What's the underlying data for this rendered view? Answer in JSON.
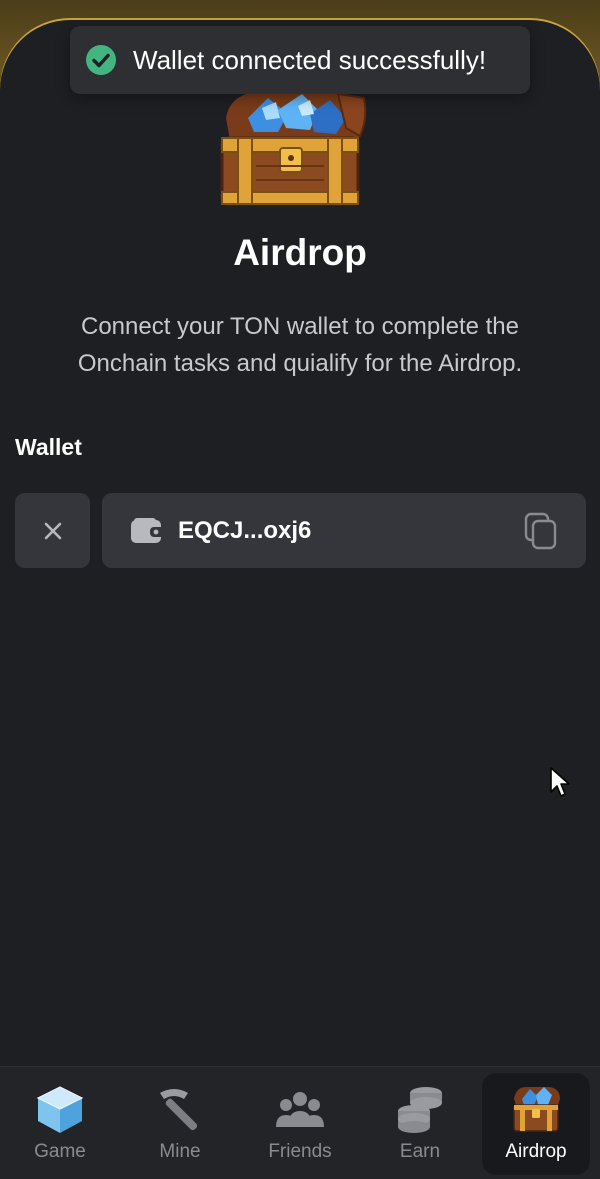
{
  "toast": {
    "message": "Wallet connected successfully!",
    "icon": "check-circle-icon",
    "color": "#43b581"
  },
  "page": {
    "title": "Airdrop",
    "description": "Connect your TON wallet to complete the Onchain tasks and quialify for the Airdrop."
  },
  "wallet": {
    "section_label": "Wallet",
    "address": "EQCJ...oxj6",
    "disconnect_icon": "close-icon",
    "wallet_icon": "wallet-icon",
    "copy_icon": "copy-icon"
  },
  "nav": {
    "items": [
      {
        "label": "Game",
        "icon": "ice-cube-icon",
        "active": false
      },
      {
        "label": "Mine",
        "icon": "pickaxe-icon",
        "active": false
      },
      {
        "label": "Friends",
        "icon": "friends-icon",
        "active": false
      },
      {
        "label": "Earn",
        "icon": "coins-stack-icon",
        "active": false
      },
      {
        "label": "Airdrop",
        "icon": "treasure-chest-icon",
        "active": true
      }
    ]
  },
  "colors": {
    "background": "#1e1f23",
    "card": "#35363b",
    "accent_gold": "#c9a43a"
  }
}
